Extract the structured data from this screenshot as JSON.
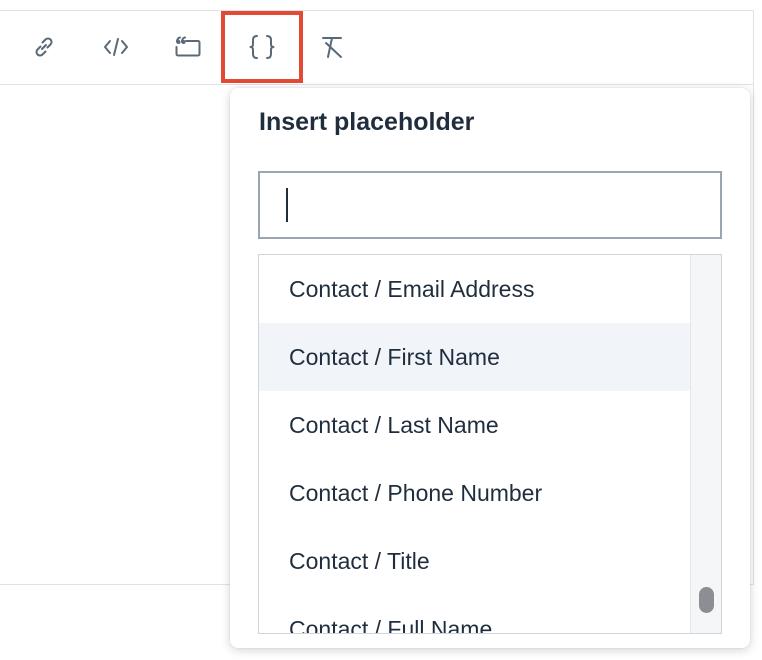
{
  "toolbar": {
    "buttons": [
      {
        "icon": "link-icon"
      },
      {
        "icon": "code-icon"
      },
      {
        "icon": "quote-icon"
      },
      {
        "icon": "placeholder-braces-icon",
        "selected": true
      },
      {
        "icon": "clear-format-icon"
      }
    ]
  },
  "popover": {
    "title": "Insert placeholder",
    "search": {
      "value": "",
      "placeholder": ""
    },
    "items": [
      {
        "label": "Contact / Email Address"
      },
      {
        "label": "Contact / First Name",
        "hover": true
      },
      {
        "label": "Contact / Last Name"
      },
      {
        "label": "Contact / Phone Number"
      },
      {
        "label": "Contact / Title"
      },
      {
        "label": "Contact / Full Name"
      }
    ]
  },
  "colors": {
    "highlight": "#e34a35",
    "icon": "#5a6978",
    "text": "#1f2d3d",
    "hover_row": "#f1f4f8"
  }
}
